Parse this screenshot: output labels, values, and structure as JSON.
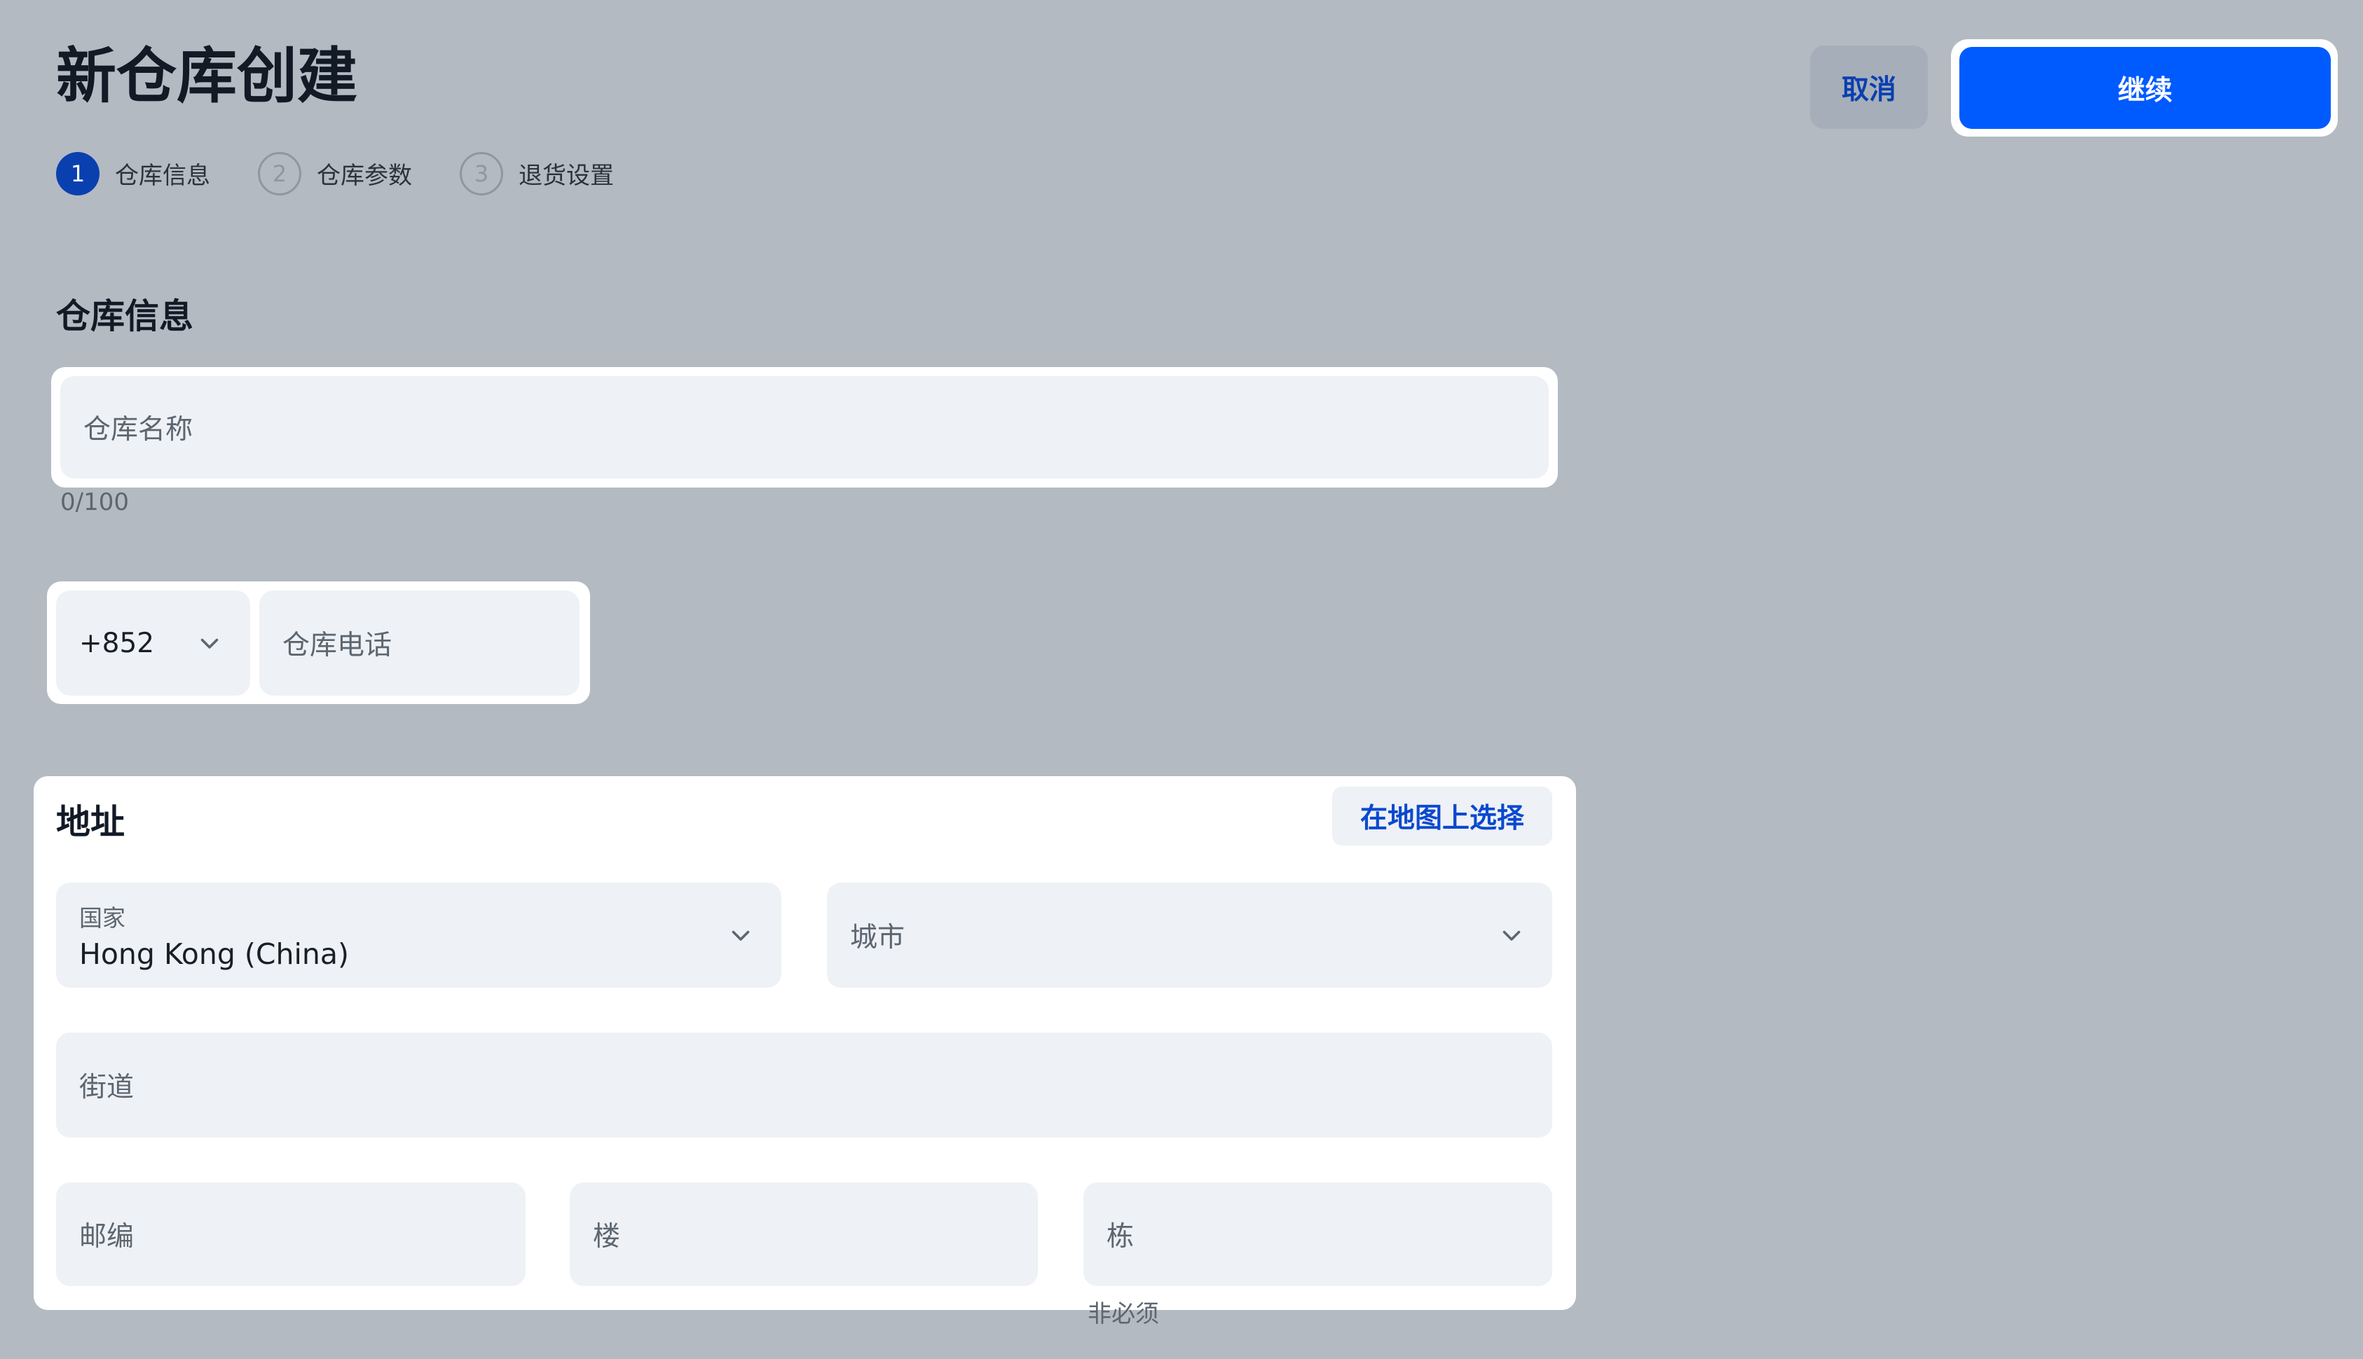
{
  "header": {
    "title": "新仓库创建",
    "cancel_label": "取消",
    "continue_label": "继续"
  },
  "steps": [
    {
      "number": "1",
      "label": "仓库信息",
      "state": "active"
    },
    {
      "number": "2",
      "label": "仓库参数",
      "state": "inactive"
    },
    {
      "number": "3",
      "label": "退货设置",
      "state": "inactive"
    }
  ],
  "warehouse_info": {
    "section_title": "仓库信息",
    "name_placeholder": "仓库名称",
    "name_counter": "0/100",
    "phone_code": "+852",
    "phone_placeholder": "仓库电话"
  },
  "address": {
    "title": "地址",
    "map_button_label": "在地图上选择",
    "country_label": "国家",
    "country_value": "Hong Kong (China)",
    "city_placeholder": "城市",
    "street_placeholder": "街道",
    "postal_placeholder": "邮编",
    "floor_placeholder": "楼",
    "building_placeholder": "栋",
    "building_hint": "非必须"
  },
  "colors": {
    "backdrop": "#b3bac2",
    "primary": "#005bff",
    "step_active": "#0a3fb0",
    "field_bg": "#eef1f5"
  },
  "icons": [
    "chevron-down-icon"
  ]
}
